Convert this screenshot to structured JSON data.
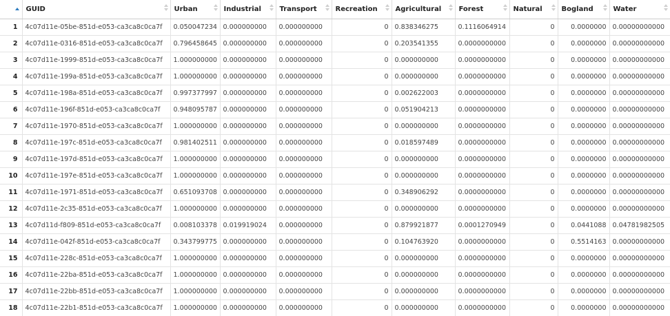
{
  "columns": [
    "GUID",
    "Urban",
    "Industrial",
    "Transport",
    "Recreation",
    "Agricultural",
    "Forest",
    "Natural",
    "Bogland",
    "Water"
  ],
  "rows": [
    [
      "1",
      "4c07d11e-05be-851d-e053-ca3ca8c0ca7f",
      "0.050047234",
      "0.000000000",
      "0.000000000",
      "0",
      "0.838346275",
      "0.1116064914",
      "0",
      "0.0000000",
      "0.00000000000"
    ],
    [
      "2",
      "4c07d11e-0316-851d-e053-ca3ca8c0ca7f",
      "0.796458645",
      "0.000000000",
      "0.000000000",
      "0",
      "0.203541355",
      "0.0000000000",
      "0",
      "0.0000000",
      "0.00000000000"
    ],
    [
      "3",
      "4c07d11e-1999-851d-e053-ca3ca8c0ca7f",
      "1.000000000",
      "0.000000000",
      "0.000000000",
      "0",
      "0.000000000",
      "0.0000000000",
      "0",
      "0.0000000",
      "0.00000000000"
    ],
    [
      "4",
      "4c07d11e-199a-851d-e053-ca3ca8c0ca7f",
      "1.000000000",
      "0.000000000",
      "0.000000000",
      "0",
      "0.000000000",
      "0.0000000000",
      "0",
      "0.0000000",
      "0.00000000000"
    ],
    [
      "5",
      "4c07d11e-198a-851d-e053-ca3ca8c0ca7f",
      "0.997377997",
      "0.000000000",
      "0.000000000",
      "0",
      "0.002622003",
      "0.0000000000",
      "0",
      "0.0000000",
      "0.00000000000"
    ],
    [
      "6",
      "4c07d11e-196f-851d-e053-ca3ca8c0ca7f",
      "0.948095787",
      "0.000000000",
      "0.000000000",
      "0",
      "0.051904213",
      "0.0000000000",
      "0",
      "0.0000000",
      "0.00000000000"
    ],
    [
      "7",
      "4c07d11e-1970-851d-e053-ca3ca8c0ca7f",
      "1.000000000",
      "0.000000000",
      "0.000000000",
      "0",
      "0.000000000",
      "0.0000000000",
      "0",
      "0.0000000",
      "0.00000000000"
    ],
    [
      "8",
      "4c07d11e-197c-851d-e053-ca3ca8c0ca7f",
      "0.981402511",
      "0.000000000",
      "0.000000000",
      "0",
      "0.018597489",
      "0.0000000000",
      "0",
      "0.0000000",
      "0.00000000000"
    ],
    [
      "9",
      "4c07d11e-197d-851d-e053-ca3ca8c0ca7f",
      "1.000000000",
      "0.000000000",
      "0.000000000",
      "0",
      "0.000000000",
      "0.0000000000",
      "0",
      "0.0000000",
      "0.00000000000"
    ],
    [
      "10",
      "4c07d11e-197e-851d-e053-ca3ca8c0ca7f",
      "1.000000000",
      "0.000000000",
      "0.000000000",
      "0",
      "0.000000000",
      "0.0000000000",
      "0",
      "0.0000000",
      "0.00000000000"
    ],
    [
      "11",
      "4c07d11e-1971-851d-e053-ca3ca8c0ca7f",
      "0.651093708",
      "0.000000000",
      "0.000000000",
      "0",
      "0.348906292",
      "0.0000000000",
      "0",
      "0.0000000",
      "0.00000000000"
    ],
    [
      "12",
      "4c07d11e-2c35-851d-e053-ca3ca8c0ca7f",
      "1.000000000",
      "0.000000000",
      "0.000000000",
      "0",
      "0.000000000",
      "0.0000000000",
      "0",
      "0.0000000",
      "0.00000000000"
    ],
    [
      "13",
      "4c07d11d-f809-851d-e053-ca3ca8c0ca7f",
      "0.008103378",
      "0.019919024",
      "0.000000000",
      "0",
      "0.879921877",
      "0.0001270949",
      "0",
      "0.0441088",
      "0.04781982505"
    ],
    [
      "14",
      "4c07d11e-042f-851d-e053-ca3ca8c0ca7f",
      "0.343799775",
      "0.000000000",
      "0.000000000",
      "0",
      "0.104763920",
      "0.0000000000",
      "0",
      "0.5514163",
      "0.00000000000"
    ],
    [
      "15",
      "4c07d11e-228c-851d-e053-ca3ca8c0ca7f",
      "1.000000000",
      "0.000000000",
      "0.000000000",
      "0",
      "0.000000000",
      "0.0000000000",
      "0",
      "0.0000000",
      "0.00000000000"
    ],
    [
      "16",
      "4c07d11e-22ba-851d-e053-ca3ca8c0ca7f",
      "1.000000000",
      "0.000000000",
      "0.000000000",
      "0",
      "0.000000000",
      "0.0000000000",
      "0",
      "0.0000000",
      "0.00000000000"
    ],
    [
      "17",
      "4c07d11e-22bb-851d-e053-ca3ca8c0ca7f",
      "1.000000000",
      "0.000000000",
      "0.000000000",
      "0",
      "0.000000000",
      "0.0000000000",
      "0",
      "0.0000000",
      "0.00000000000"
    ],
    [
      "18",
      "4c07d11e-22b1-851d-e053-ca3ca8c0ca7f",
      "1.000000000",
      "0.000000000",
      "0.000000000",
      "0",
      "0.000000000",
      "0.0000000000",
      "0",
      "0.0000000",
      "0.00000000000"
    ]
  ]
}
